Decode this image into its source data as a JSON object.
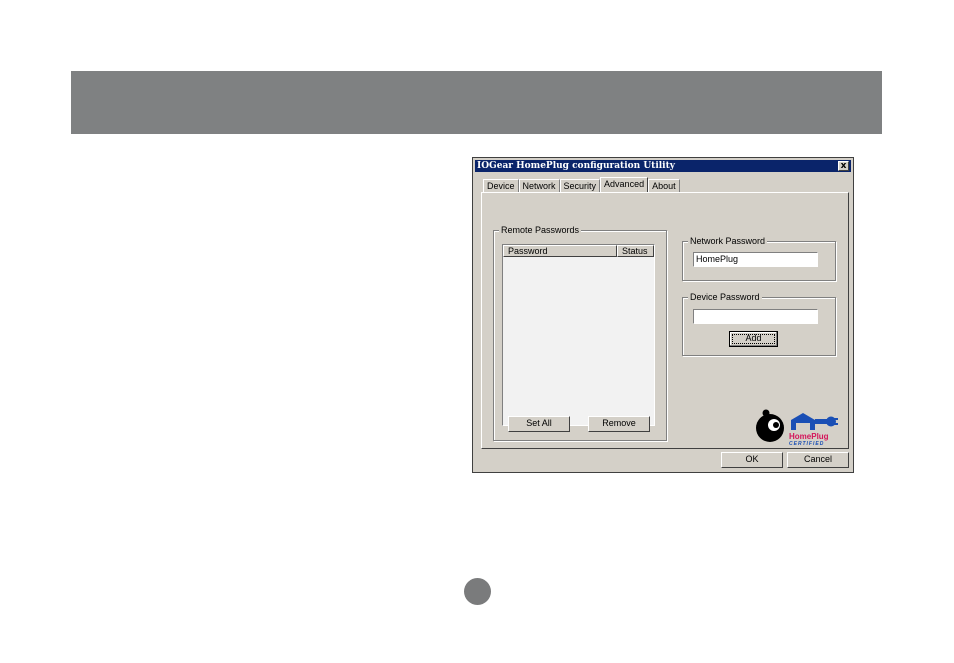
{
  "dialog": {
    "title": "IOGear HomePlug configuration Utility",
    "close_label": "x"
  },
  "tabs": [
    {
      "label": "Device"
    },
    {
      "label": "Network"
    },
    {
      "label": "Security"
    },
    {
      "label": "Advanced",
      "active": true
    },
    {
      "label": "About"
    }
  ],
  "remote_passwords": {
    "group_label": "Remote Passwords",
    "columns": [
      "Password",
      "Status"
    ],
    "rows": []
  },
  "network_password": {
    "group_label": "Network Password",
    "value": "HomePlug"
  },
  "device_password": {
    "group_label": "Device Password",
    "value": "",
    "add_label": "Add"
  },
  "buttons": {
    "set_all": "Set All",
    "remove": "Remove",
    "ok": "OK",
    "cancel": "Cancel"
  },
  "logo": {
    "brand": "HomePlug",
    "certified": "CERTIFIED"
  },
  "colors": {
    "titlebar": "#0a246a",
    "dialog_face": "#d4d0c8",
    "header_band": "#7f8182",
    "homeplug_blue": "#1a4fb5",
    "homeplug_red": "#d4145a"
  }
}
